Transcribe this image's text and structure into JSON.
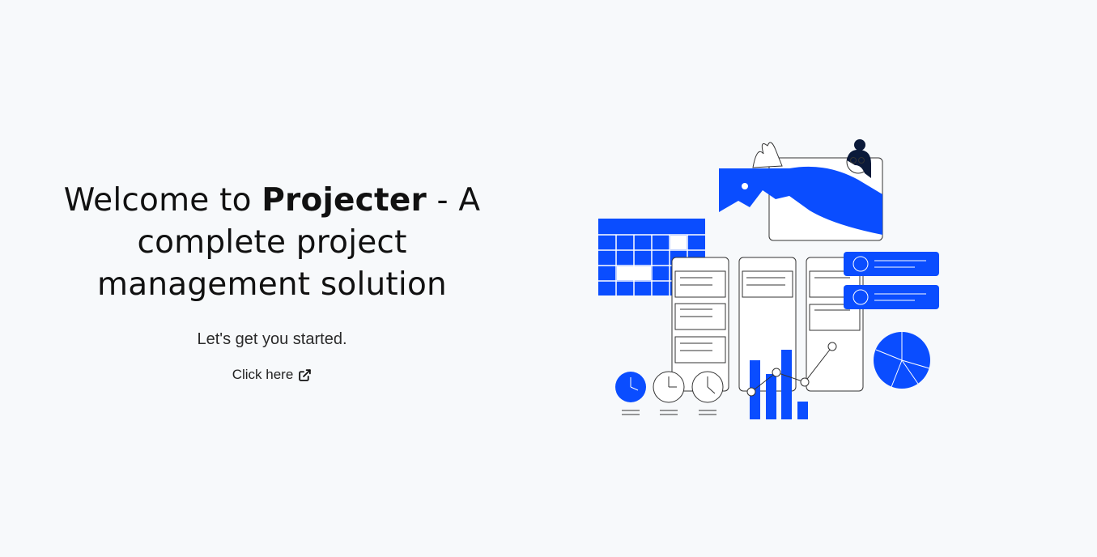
{
  "hero": {
    "title_prefix": "Welcome to ",
    "brand": "Projecter",
    "title_suffix": " - A complete project management solution",
    "subtitle": "Let's get you started.",
    "cta_label": "Click here",
    "cta_icon": "external-link-icon"
  },
  "colors": {
    "background": "#f7f9fb",
    "accent": "#0a4dff",
    "text": "#111111",
    "line": "#333333"
  }
}
